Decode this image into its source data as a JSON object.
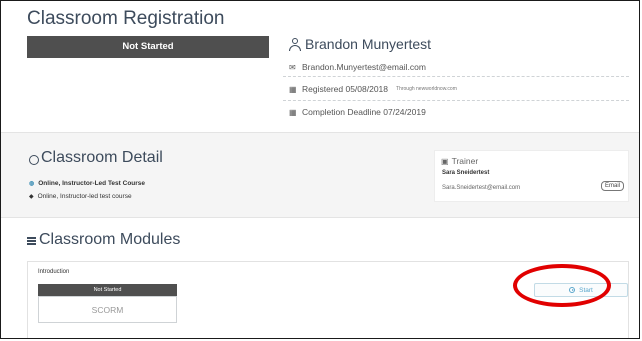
{
  "registration": {
    "title": "Classroom Registration",
    "status": "Not Started",
    "user_name": "Brandon Munyertest",
    "email": "Brandon.Munyertest@email.com",
    "registered": "Registered 05/08/2018",
    "through": "Through newworldnow.com",
    "deadline": "Completion Deadline 07/24/2019"
  },
  "detail": {
    "title": "Classroom Detail",
    "line1": "Online, Instructor-Led Test Course",
    "line2": "Online, Instructor-led test course",
    "trainer_label": "Trainer",
    "trainer_name": "Sara Sneidertest",
    "trainer_email": "Sara.Sneidertest@email.com",
    "email_button": "Email"
  },
  "modules": {
    "title": "Classroom Modules",
    "items": [
      {
        "name": "Introduction",
        "status": "Not Started",
        "type": "SCORM",
        "action_label": "Start"
      }
    ]
  },
  "colors": {
    "heading": "#3d4b5c",
    "status_bg": "#4f4f4f",
    "start_accent": "#5aa7cc",
    "highlight_ring": "#e10000"
  },
  "icons": {
    "user": "user-icon",
    "email": "envelope-icon",
    "calendar": "calendar-icon",
    "globe": "globe-icon",
    "list": "list-icon",
    "trainer": "id-card-icon",
    "start": "play-circle-icon"
  }
}
